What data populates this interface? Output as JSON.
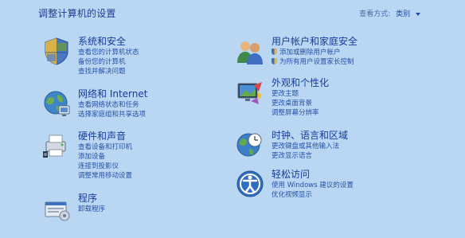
{
  "page": {
    "title": "调整计算机的设置",
    "view_by_label": "查看方式:",
    "view_by_value": "类别"
  },
  "categories": [
    {
      "title": "系统和安全",
      "icon": "system-security-icon",
      "links": [
        "查看您的计算机状态",
        "备份您的计算机",
        "查找并解决问题"
      ]
    },
    {
      "title": "网络和 Internet",
      "icon": "network-internet-icon",
      "links": [
        "查看网络状态和任务",
        "选择家庭组和共享选项"
      ]
    },
    {
      "title": "硬件和声音",
      "icon": "hardware-sound-icon",
      "links": [
        "查看设备和打印机",
        "添加设备",
        "连接到投影仪",
        "调整常用移动设置"
      ]
    },
    {
      "title": "程序",
      "icon": "programs-icon",
      "links": [
        "卸载程序"
      ]
    },
    {
      "title": "用户帐户和家庭安全",
      "icon": "user-accounts-icon",
      "links": [
        "添加或删除用户帐户",
        "为所有用户设置家长控制"
      ]
    },
    {
      "title": "外观和个性化",
      "icon": "appearance-personalization-icon",
      "links": [
        "更改主题",
        "更改桌面背景",
        "调整屏幕分辨率"
      ]
    },
    {
      "title": "时钟、语言和区域",
      "icon": "clock-language-region-icon",
      "links": [
        "更改键盘或其他输入法",
        "更改显示语言"
      ]
    },
    {
      "title": "轻松访问",
      "icon": "ease-of-access-icon",
      "links": [
        "使用 Windows 建议的设置",
        "优化视频显示"
      ]
    }
  ]
}
